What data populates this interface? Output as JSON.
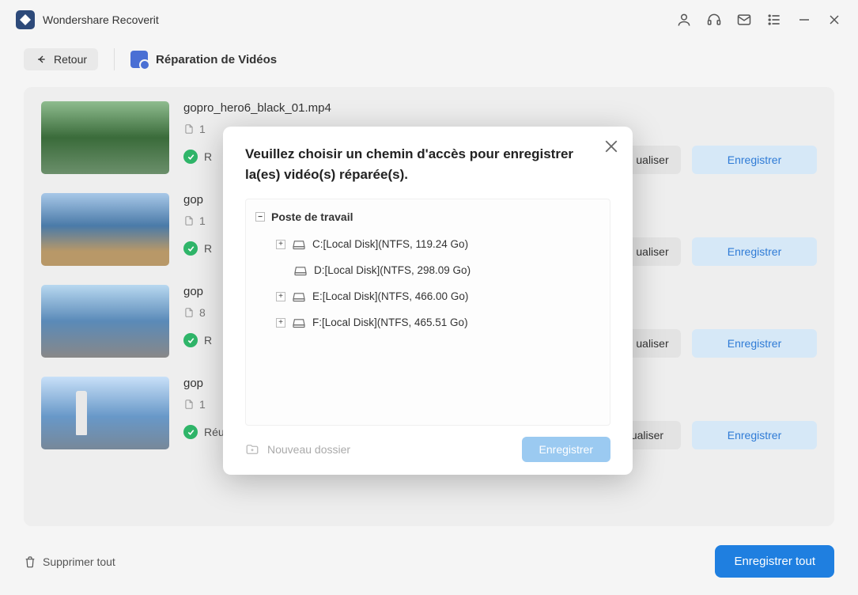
{
  "app": {
    "title": "Wondershare Recoverit"
  },
  "toolbar": {
    "back": "Retour",
    "page_title": "Réparation de Vidéos"
  },
  "files": [
    {
      "name": "gopro_hero6_black_01.mp4",
      "meta_trunc": "1",
      "status": "R"
    },
    {
      "name": "gop",
      "meta_trunc": "1",
      "status": "R"
    },
    {
      "name": "gop",
      "meta_trunc": "8",
      "status": "R"
    },
    {
      "name": "gop",
      "meta_trunc": "1",
      "status": "Réussi"
    }
  ],
  "actions": {
    "preview": "Prévisualiser",
    "preview_trunc": "ualiser",
    "save": "Enregistrer"
  },
  "footer": {
    "delete_all": "Supprimer tout",
    "save_all": "Enregistrer tout"
  },
  "modal": {
    "title": "Veuillez choisir un chemin d'accès pour enregistrer la(es) vidéo(s) réparée(s).",
    "root": "Poste de travail",
    "disks": [
      {
        "label": "C:[Local Disk](NTFS, 119.24 Go)",
        "expandable": true
      },
      {
        "label": "D:[Local Disk](NTFS, 298.09 Go)",
        "expandable": false
      },
      {
        "label": "E:[Local Disk](NTFS, 466.00 Go)",
        "expandable": true
      },
      {
        "label": "F:[Local Disk](NTFS, 465.51 Go)",
        "expandable": true
      }
    ],
    "new_folder": "Nouveau dossier",
    "save": "Enregistrer"
  }
}
